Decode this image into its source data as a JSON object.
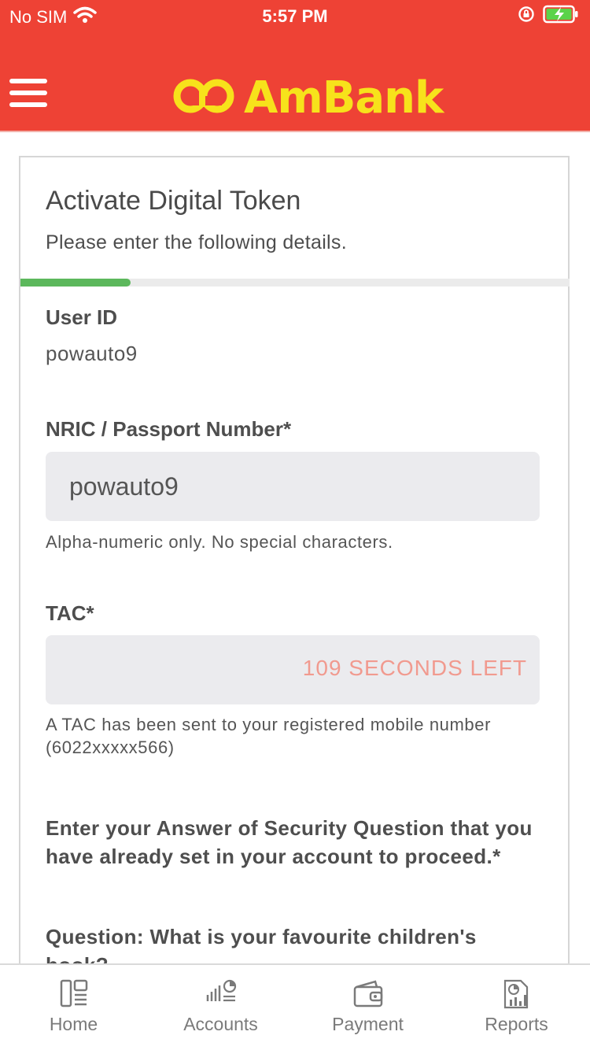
{
  "status": {
    "carrier": "No SIM",
    "time": "5:57 PM"
  },
  "header": {
    "logo_text": "AmBank",
    "brand_color": "#ee4235",
    "logo_color": "#f7e21b"
  },
  "card": {
    "title": "Activate Digital Token",
    "subtitle": "Please enter the following details.",
    "progress_fraction": 0.2,
    "user_id_label": "User ID",
    "user_id_value": "powauto9",
    "nric_label": "NRIC / Passport Number*",
    "nric_value": "powauto9",
    "nric_hint": "Alpha-numeric only. No special characters.",
    "tac_label": "TAC*",
    "tac_value": "",
    "tac_countdown": "109 SECONDS LEFT",
    "tac_hint": "A TAC has been sent to your registered mobile number (6022xxxxx566)",
    "security_prompt": "Enter your Answer of Security Question that you have already set in your account to proceed.*",
    "security_question": "Question: What is your favourite children's book?"
  },
  "bottom_nav": {
    "items": [
      {
        "label": "Home",
        "icon": "home-dashboard-icon"
      },
      {
        "label": "Accounts",
        "icon": "accounts-chart-icon"
      },
      {
        "label": "Payment",
        "icon": "wallet-icon"
      },
      {
        "label": "Reports",
        "icon": "report-icon"
      }
    ]
  }
}
